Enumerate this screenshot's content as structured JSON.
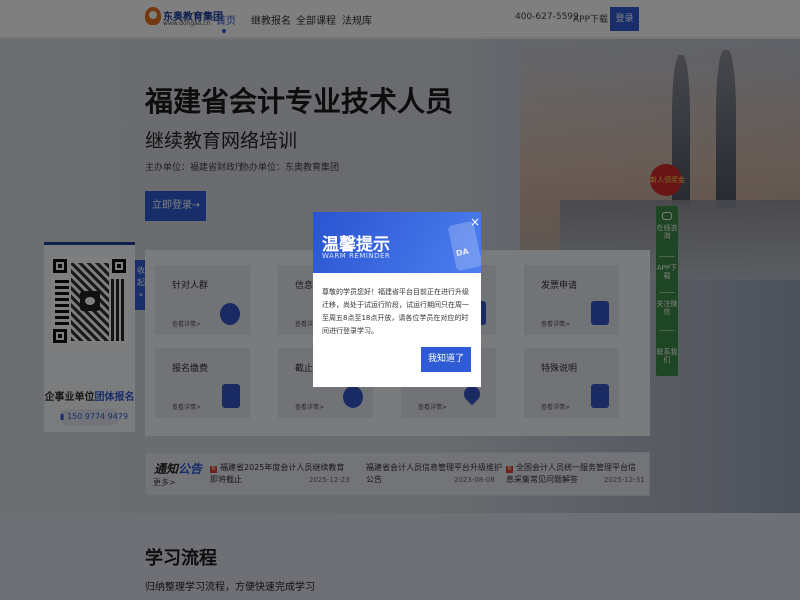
{
  "header": {
    "logo_name": "东奥教育集团",
    "logo_url": "www.dongao.cn",
    "nav": [
      {
        "label": "首页",
        "active": true
      },
      {
        "label": "继教报名",
        "active": false
      },
      {
        "label": "全部课程",
        "active": false
      },
      {
        "label": "法规库",
        "active": false
      }
    ],
    "phone": "400-627-5599",
    "app_download": "APP下载",
    "login": "登录"
  },
  "hero": {
    "title": "福建省会计专业技术人员",
    "subtitle": "继续教育网络培训",
    "host": "主办单位：福建省财政厅",
    "co_host": "协办单位：东奥教育集团",
    "login_button": "立即登录",
    "arrow": "→"
  },
  "qr_card": {
    "text_prefix": "企事业单位",
    "text_highlight": "团体报名",
    "phone": "150 9774 9479"
  },
  "fold_tab": "收起",
  "services": [
    {
      "name": "针对人群",
      "more": "查看详情>",
      "icon": "person-icon"
    },
    {
      "name": "信息采集",
      "more": "查看详情>",
      "icon": "form-icon"
    },
    {
      "name": "",
      "more": "",
      "icon": "book-icon"
    },
    {
      "name": "发票申请",
      "more": "查看详情>",
      "icon": "stamp-icon"
    },
    {
      "name": "报名缴费",
      "more": "查看详情>",
      "icon": "wallet-icon"
    },
    {
      "name": "截止时间",
      "more": "查看详情>",
      "icon": "clock-icon"
    },
    {
      "name": "",
      "more": "查看详情>",
      "icon": "pin-icon"
    },
    {
      "name": "特殊说明",
      "more": "查看详情>",
      "icon": "question-icon"
    }
  ],
  "notice": {
    "title_a": "通知",
    "title_b": "公告",
    "more": "更多>",
    "badge": "N",
    "items": [
      {
        "text": "福建省2025年度会计人员继续教育即将截止",
        "date": "2025-12-23",
        "badge": true
      },
      {
        "text": "福建省会计人员信息管理平台升级维护公告",
        "date": "2023-08-08",
        "badge": false
      },
      {
        "text": "全国会计人员统一服务管理平台信息采集常见问题解答",
        "date": "2025-12-31",
        "badge": true
      }
    ]
  },
  "learn": {
    "title": "学习流程",
    "subtitle": "归纳整理学习流程，方便快速完成学习"
  },
  "side_float": {
    "badge": "新人领奖金",
    "items": [
      "在线咨询",
      "APP下载",
      "关注微信",
      "联系我们"
    ]
  },
  "dialog": {
    "title": "温馨提示",
    "title_en": "WARM REMINDER",
    "deco": "DA",
    "close": "×",
    "body": "尊敬的学员您好！福建省平台目前正在进行升级迁移，尚处于试运行阶段，试运行期间只在周一至周五8点至18点开放，请各位学员在对应的时间进行登录学习。",
    "confirm": "我知道了"
  },
  "colors": {
    "brand": "#2f5cd6",
    "side_green": "#3e8c48",
    "badge_red": "#e0432f"
  }
}
